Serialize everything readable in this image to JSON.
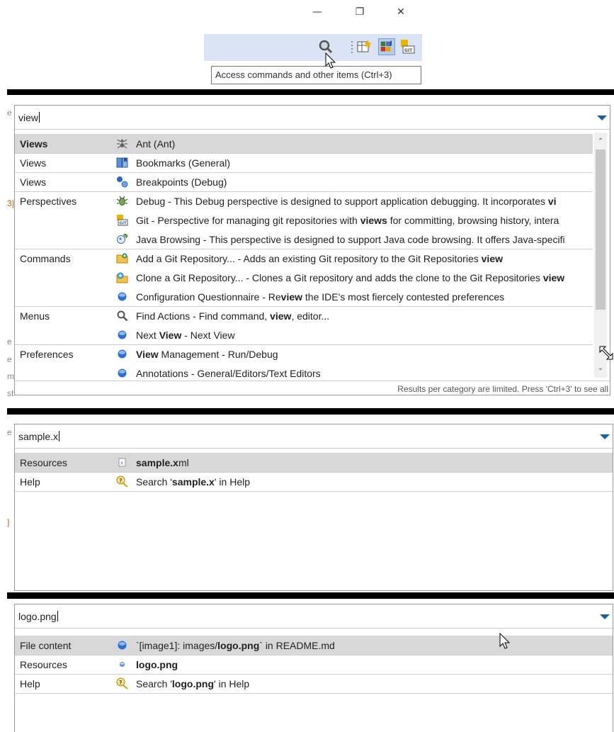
{
  "window_controls": {
    "minimize": "—",
    "restore": "❐",
    "close": "✕"
  },
  "tooltip": "Access commands and other items (Ctrl+3)",
  "colors": {
    "selection": "#d8d8d8",
    "toolbar": "#dae4f4",
    "accent_arrow": "#1a5f9e"
  },
  "panel1": {
    "query": "view",
    "rows": [
      {
        "category": "Views",
        "icon": "ant-icon",
        "pre": "Ant (Ant)",
        "bold": "",
        "post": ""
      },
      {
        "category": "Views",
        "icon": "bookmarks-icon",
        "pre": "Bookmarks (General)",
        "bold": "",
        "post": ""
      },
      {
        "category": "Views",
        "icon": "breakpoints-icon",
        "pre": "Breakpoints (Debug)",
        "bold": "",
        "post": ""
      },
      {
        "category": "Perspectives",
        "icon": "debug-icon",
        "pre": "Debug - This Debug perspective is designed to support application debugging. It incorporates ",
        "bold": "vi",
        "post": ""
      },
      {
        "category": "",
        "icon": "git-icon",
        "pre": "Git - Perspective for managing git repositories with ",
        "bold": "views",
        "post": " for committing, browsing history, intera"
      },
      {
        "category": "",
        "icon": "java-browsing-icon",
        "pre": "Java Browsing - This perspective is designed to support Java code browsing. It offers Java-specifi",
        "bold": "",
        "post": ""
      },
      {
        "category": "Commands",
        "icon": "add-repo-icon",
        "pre": "Add a Git Repository... - Adds an existing Git repository to the Git Repositories ",
        "bold": "view",
        "post": ""
      },
      {
        "category": "",
        "icon": "clone-repo-icon",
        "pre": "Clone a Git Repository... - Clones a Git repository and adds the clone to the Git Repositories ",
        "bold": "view",
        "post": ""
      },
      {
        "category": "",
        "icon": "blue-dot-icon",
        "pre": "Configuration Questionnaire - Re",
        "bold": "view",
        "post": " the IDE's most fiercely contested preferences"
      },
      {
        "category": "Menus",
        "icon": "search-icon",
        "pre": "Find Actions - Find command, ",
        "bold": "view",
        "post": ", editor..."
      },
      {
        "category": "",
        "icon": "blue-dot-icon",
        "pre": "Next ",
        "bold": "View",
        "post": " - Next View"
      },
      {
        "category": "Preferences",
        "icon": "blue-dot-icon",
        "pre": "",
        "bold": "View",
        "post": " Management - Run/Debug"
      },
      {
        "category": "",
        "icon": "blue-dot-icon",
        "pre": "Annotations - General/Editors/Text Editors",
        "bold": "",
        "post": ""
      }
    ],
    "footer": "Results per category are limited. Press 'Ctrl+3' to see all"
  },
  "panel2": {
    "query": "sample.x",
    "rows": [
      {
        "category": "Resources",
        "icon": "xml-file-icon",
        "pre": "",
        "bold": "sample.x",
        "post": "ml"
      },
      {
        "category": "Help",
        "icon": "help-icon",
        "pre": "Search '",
        "bold": "sample.x",
        "post": "' in Help"
      }
    ]
  },
  "panel3": {
    "query": "logo.png",
    "rows": [
      {
        "category": "File content",
        "icon": "blue-dot-icon",
        "pre": "`[image1]: images/",
        "bold": "logo.png",
        "post": "` in README.md"
      },
      {
        "category": "Resources",
        "icon": "image-file-icon",
        "pre": "",
        "bold": "logo.png",
        "post": ""
      },
      {
        "category": "Help",
        "icon": "help-icon",
        "pre": "Search '",
        "bold": "logo.png",
        "post": "' in Help"
      }
    ]
  }
}
